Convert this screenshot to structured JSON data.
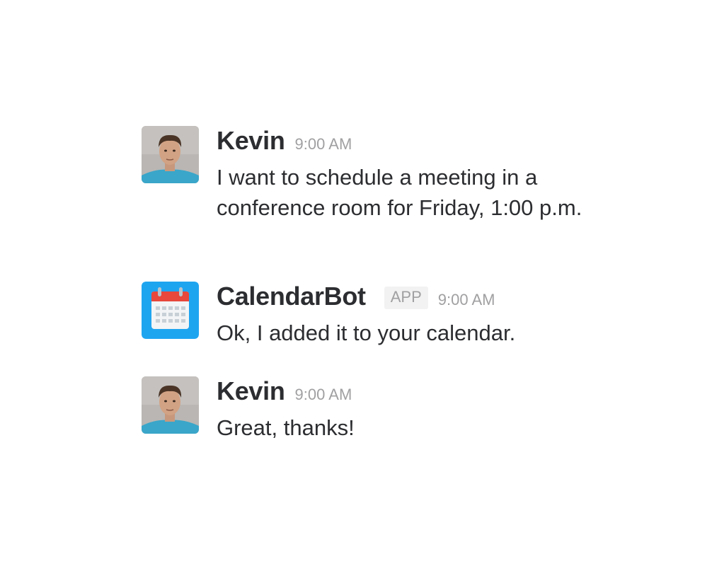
{
  "messages": [
    {
      "sender": "Kevin",
      "time": "9:00 AM",
      "badge": "",
      "text": "I want to schedule a meeting in a conference room for Friday, 1:00 p.m."
    },
    {
      "sender": "CalendarBot",
      "time": "9:00 AM",
      "badge": "APP",
      "text": "Ok, I added it to your calendar."
    },
    {
      "sender": "Kevin",
      "time": "9:00 AM",
      "badge": "",
      "text": "Great, thanks!"
    }
  ],
  "colors": {
    "text": "#2c2d30",
    "muted": "#a0a0a2",
    "badge_bg": "#f2f2f2",
    "calendar_blue": "#1ea5f0",
    "calendar_red": "#e8473b"
  },
  "icons": {
    "user_avatar": "avatar",
    "bot_avatar": "calendar-icon"
  }
}
